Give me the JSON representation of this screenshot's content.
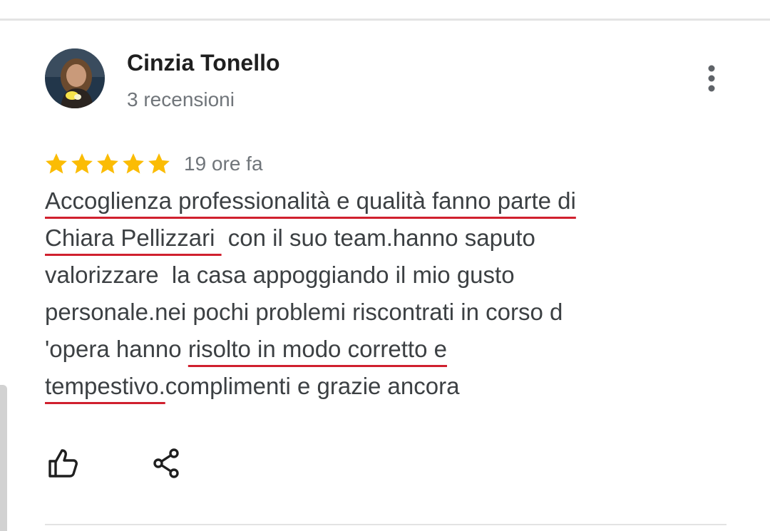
{
  "review": {
    "author_name": "Cinzia Tonello",
    "author_review_count": "3 recensioni",
    "rating": 5,
    "rating_max": 5,
    "time_ago": "19 ore fa",
    "text_lines": [
      {
        "before": "",
        "highlight": "Accoglienza professionalità e qualità fanno parte di",
        "after": ""
      },
      {
        "before": "",
        "highlight": "Chiara Pellizzari ",
        "after": " con il suo team.hanno saputo"
      },
      {
        "before": "valorizzare  la casa appoggiando il mio gusto",
        "highlight": "",
        "after": ""
      },
      {
        "before": "personale.nei pochi problemi riscontrati in corso d",
        "highlight": "",
        "after": ""
      },
      {
        "before": "'opera hanno ",
        "highlight": "risolto in modo corretto e",
        "after": ""
      },
      {
        "before": "",
        "highlight": "tempestivo.",
        "after": "complimenti e grazie ancora"
      }
    ]
  },
  "icons": {
    "avatar": "avatar",
    "more": "more-vert-icon",
    "star": "star-icon",
    "like": "thumb-up-icon",
    "share": "share-icon"
  },
  "colors": {
    "star": "#fbbc04",
    "underline": "#d0202e",
    "text": "#3c4043",
    "secondary_text": "#70757a"
  }
}
